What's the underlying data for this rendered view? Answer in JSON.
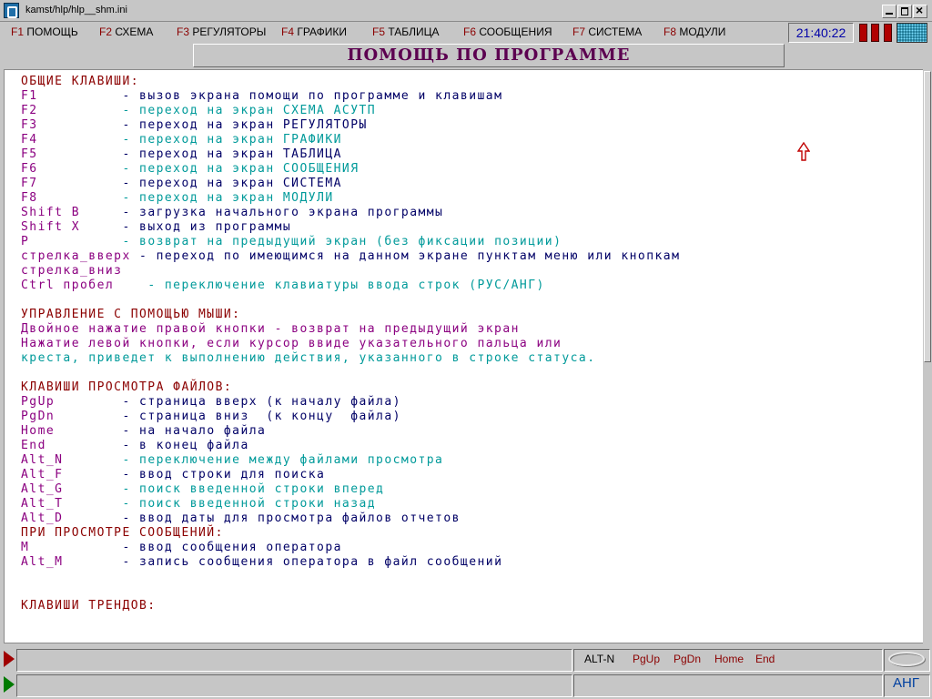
{
  "window": {
    "title": "kamst/hlp/hlp__shm.ini"
  },
  "menu": [
    {
      "key": "F1",
      "label": "ПОМОЩЬ"
    },
    {
      "key": "F2",
      "label": "СХЕМА"
    },
    {
      "key": "F3",
      "label": "РЕГУЛЯТОРЫ"
    },
    {
      "key": "F4",
      "label": "ГРАФИКИ"
    },
    {
      "key": "F5",
      "label": "ТАБЛИЦА"
    },
    {
      "key": "F6",
      "label": "СООБЩЕНИЯ"
    },
    {
      "key": "F7",
      "label": "СИСТЕМА"
    },
    {
      "key": "F8",
      "label": "МОДУЛИ"
    }
  ],
  "clock": "21:40:22",
  "colors": {
    "indicator": "#b00000",
    "heading": "#8b0000",
    "key": "#8b0080",
    "text": "#000066",
    "alt_text": "#009a9a"
  },
  "heading": "ПОМОЩЬ ПО ПРОГРАММЕ",
  "sections": {
    "general": {
      "title": "ОБЩИЕ КЛАВИШИ:",
      "rows": [
        {
          "key": "F1          ",
          "desc": "- вызов экрана помощи по программе и клавишам"
        },
        {
          "key": "F2          ",
          "desc": "- переход на экран СХЕМА АСУТП"
        },
        {
          "key": "F3          ",
          "desc": "- переход на экран РЕГУЛЯТОРЫ"
        },
        {
          "key": "F4          ",
          "desc": "- переход на экран ГРАФИКИ"
        },
        {
          "key": "F5          ",
          "desc": "- переход на экран ТАБЛИЦА"
        },
        {
          "key": "F6          ",
          "desc": "- переход на экран СООБЩЕНИЯ"
        },
        {
          "key": "F7          ",
          "desc": "- переход на экран СИСТЕМА"
        },
        {
          "key": "F8          ",
          "desc": "- переход на экран МОДУЛИ"
        },
        {
          "key": "Shift B     ",
          "desc": "- загрузка начального экрана программы"
        },
        {
          "key": "Shift X     ",
          "desc": "- выход из программы"
        },
        {
          "key": "P           ",
          "desc": "- возврат на предыдущий экран (без фиксации позиции)"
        },
        {
          "key": "стрелка_вверх ",
          "desc": "- переход по имеющимся на данном экране пунктам меню или кнопкам"
        },
        {
          "key": "стрелка_вниз",
          "desc": ""
        },
        {
          "key": "Ctrl пробел    ",
          "desc": "- переключение клавиатуры ввода строк (РУС/АНГ)"
        }
      ]
    },
    "mouse": {
      "title": "УПРАВЛЕНИЕ С ПОМОЩЬЮ МЫШИ:",
      "lines": [
        "Двойное нажатие правой кнопки - возврат на предыдущий экран",
        "Нажатие левой кнопки, если курсор ввиде указательного пальца или",
        "креста, приведет к выполнению действия, указанного в строке статуса."
      ]
    },
    "viewer": {
      "title": "КЛАВИШИ ПРОСМОТРА ФАЙЛОВ:",
      "rows": [
        {
          "key": "PgUp        ",
          "desc": "- страница вверх (к началу файла)"
        },
        {
          "key": "PgDn        ",
          "desc": "- страница вниз  (к концу  файла)"
        },
        {
          "key": "Home        ",
          "desc": "- на начало файла"
        },
        {
          "key": "End         ",
          "desc": "- в конец файла"
        },
        {
          "key": "Alt_N       ",
          "desc": "- переключение между файлами просмотра"
        },
        {
          "key": "Alt_F       ",
          "desc": "- ввод строки для поиска"
        },
        {
          "key": "Alt_G       ",
          "desc": "- поиск введенной строки вперед"
        },
        {
          "key": "Alt_T       ",
          "desc": "- поиск введенной строки назад"
        },
        {
          "key": "Alt_D       ",
          "desc": "- ввод даты для просмотра файлов отчетов"
        }
      ]
    },
    "messages": {
      "title": "ПРИ ПРОСМОТРЕ СООБЩЕНИЙ:",
      "rows": [
        {
          "key": "M           ",
          "desc": "- ввод сообщения оператора"
        },
        {
          "key": "Alt_M       ",
          "desc": "- запись сообщения оператора в файл сообщений"
        }
      ]
    },
    "trends": {
      "title": "КЛАВИШИ ТРЕНДОВ:"
    }
  },
  "status": {
    "keys": [
      "ALT-N",
      "PgUp",
      "PgDn",
      "Home",
      "End"
    ],
    "language": "АНГ"
  }
}
